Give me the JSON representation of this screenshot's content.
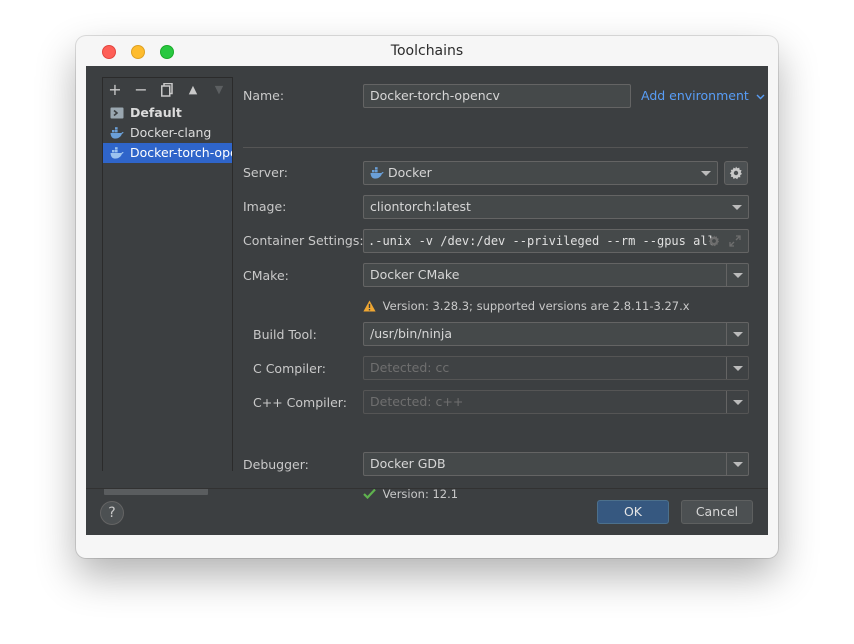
{
  "window": {
    "title": "Toolchains"
  },
  "toolbar": {
    "add": "+",
    "remove": "−",
    "copy": "⧉",
    "up": "▲",
    "down": "▼"
  },
  "toolchains": [
    {
      "label": "Default",
      "icon": "terminal-icon",
      "selected": false
    },
    {
      "label": "Docker-clang",
      "icon": "docker-icon",
      "selected": false
    },
    {
      "label": "Docker-torch-opencv",
      "icon": "docker-icon",
      "selected": true
    }
  ],
  "form": {
    "name_label": "Name:",
    "name_value": "Docker-torch-opencv",
    "add_env_label": "Add environment",
    "server_label": "Server:",
    "server_value": "Docker",
    "image_label": "Image:",
    "image_value": "cliontorch:latest",
    "container_label": "Container Settings:",
    "container_value": ".-unix -v /dev:/dev --privileged --rm --gpus all",
    "cmake_label": "CMake:",
    "cmake_value": "Docker CMake",
    "cmake_status": "Version: 3.28.3; supported versions are 2.8.11-3.27.x",
    "build_tool_label": "Build Tool:",
    "build_tool_value": "/usr/bin/ninja",
    "c_compiler_label": "C Compiler:",
    "c_compiler_placeholder": "Detected: cc",
    "cpp_compiler_label": "C++ Compiler:",
    "cpp_compiler_placeholder": "Detected: c++",
    "debugger_label": "Debugger:",
    "debugger_value": "Docker GDB",
    "debugger_status": "Version: 12.1"
  },
  "footer": {
    "help": "?",
    "ok": "OK",
    "cancel": "Cancel"
  },
  "colors": {
    "accent": "#2f65ca",
    "link": "#589df6",
    "warning": "#f0a732",
    "success": "#5fb24e"
  }
}
